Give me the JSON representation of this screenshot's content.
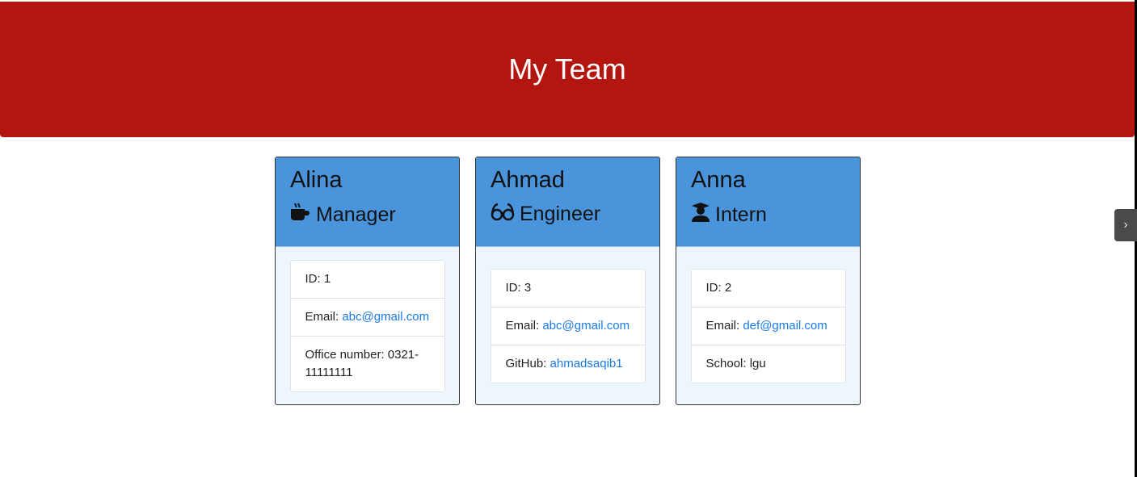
{
  "header": {
    "title": "My Team"
  },
  "colors": {
    "header": "#b3160f",
    "card_header": "#4a94dc",
    "link": "#1a7ae8"
  },
  "cards": [
    {
      "name": "Alina",
      "role": "Manager",
      "icon": "coffee-icon",
      "items": [
        {
          "label": "ID: ",
          "value": "1"
        },
        {
          "label": "Email: ",
          "value": "abc@gmail.com",
          "link": true
        },
        {
          "label": "Office number: ",
          "value": "0321-11111111"
        }
      ]
    },
    {
      "name": "Ahmad",
      "role": "Engineer",
      "icon": "glasses-icon",
      "items": [
        {
          "label": "ID: ",
          "value": "3"
        },
        {
          "label": "Email: ",
          "value": "abc@gmail.com",
          "link": true
        },
        {
          "label": "GitHub: ",
          "value": "ahmadsaqib1",
          "link": true
        }
      ]
    },
    {
      "name": "Anna",
      "role": "Intern",
      "icon": "graduate-icon",
      "items": [
        {
          "label": "ID: ",
          "value": "2"
        },
        {
          "label": "Email: ",
          "value": "def@gmail.com",
          "link": true
        },
        {
          "label": "School: ",
          "value": "lgu"
        }
      ]
    }
  ],
  "sidebar_toggle": {
    "icon": "chevron-right-icon",
    "glyph": "›"
  }
}
